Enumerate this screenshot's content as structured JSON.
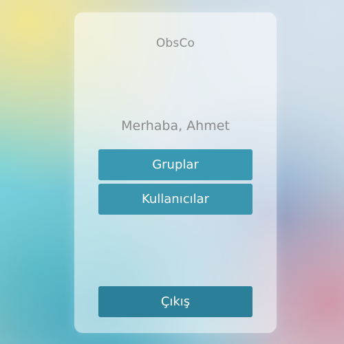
{
  "app": {
    "title": "ObsCo"
  },
  "main": {
    "greeting": "Merhaba, Ahmet",
    "menu": [
      {
        "label": "Gruplar"
      },
      {
        "label": "Kullanıcılar"
      }
    ],
    "logout_label": "Çıkış"
  },
  "colors": {
    "button_primary": "#3a99b2",
    "button_logout": "#2c7f98",
    "text_muted": "#8a8a8a"
  }
}
